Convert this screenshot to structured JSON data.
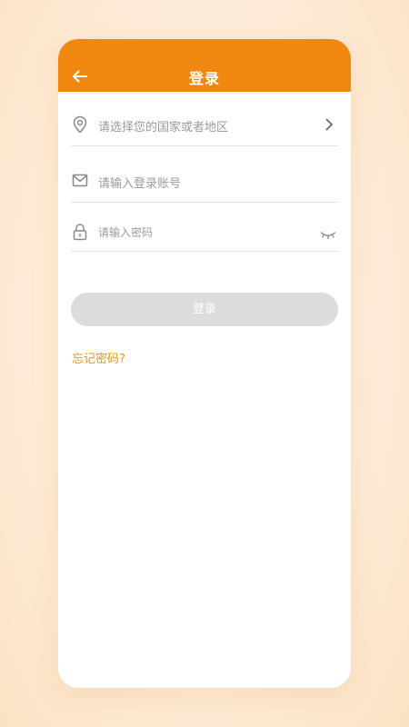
{
  "header": {
    "title": "登录",
    "back_icon": "arrow-left-icon"
  },
  "form": {
    "region": {
      "placeholder": "请选择您的国家或者地区",
      "icon": "location-pin-icon",
      "trailing_icon": "chevron-right-icon"
    },
    "account": {
      "placeholder": "请输入登录账号",
      "icon": "envelope-icon"
    },
    "password": {
      "placeholder": "请输入密码",
      "icon": "lock-icon",
      "trailing_icon": "eye-closed-icon"
    },
    "login_label": "登录",
    "forgot_label": "忘记密码?"
  },
  "colors": {
    "accent": "#f0880f",
    "link": "#e09a17",
    "button_disabled": "#dcdcdc"
  }
}
